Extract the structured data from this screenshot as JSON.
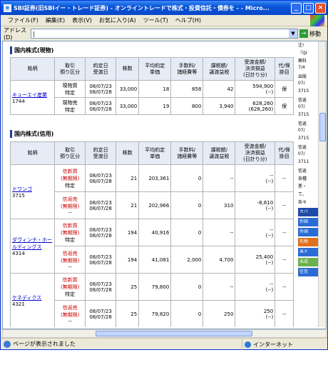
{
  "window": {
    "title": "SBI証券(旧SBIイー・トレード証券) - オンライントレードで株式・投資信託・債券を - - Micro..."
  },
  "menu": [
    "ファイル(F)",
    "編集(E)",
    "表示(V)",
    "お気に入り(A)",
    "ツール(T)",
    "ヘルプ(H)"
  ],
  "address": {
    "label": "アドレス(D)",
    "value": "",
    "go": "移動"
  },
  "spot": {
    "title": "国内株式(現物)",
    "headers": [
      "銘柄",
      "取引\n預り区分",
      "約定日\n受渡日",
      "株数",
      "平均約定\n単価",
      "手数料/\n諸経費等",
      "課税額/\n譲渡益税",
      "受渡金額/\n決済損益\n(日計り分)",
      "代/保\n掛目"
    ],
    "name": "キューエイ産業",
    "code": "1744",
    "rows": [
      {
        "kind": "現物買",
        "acct": "特定",
        "date": "08/07/23",
        "settle": "08/07/28",
        "qty": "33,000",
        "price": "18",
        "fee": "858",
        "tax": "42",
        "amount": "594,900",
        "pl": "(--)",
        "flag": "保"
      },
      {
        "kind": "現物売",
        "acct": "特定",
        "date": "08/07/23",
        "settle": "08/07/28",
        "qty": "33,000",
        "price": "19",
        "fee": "800",
        "tax": "3,940",
        "amount": "628,260",
        "pl": "(628,260)",
        "flag": "保"
      }
    ]
  },
  "margin": {
    "title": "国内株式(信用)",
    "headers": [
      "銘柄",
      "取引\n預り区分",
      "約定日\n受渡日",
      "株数",
      "平均約定\n単価",
      "手数料/\n諸経費等",
      "課税額/\n譲渡益税",
      "受渡金額/\n決済損益\n(日計り分)",
      "代/保\n掛目"
    ],
    "groups": [
      {
        "name": "ドワンゴ",
        "code": "3715",
        "rows": [
          {
            "kind": "信新買",
            "term": "(無期限)",
            "acct": "特定",
            "date": "08/07/23",
            "settle": "08/07/28",
            "qty": "21",
            "price": "203,361",
            "fee": "0",
            "tax": "--",
            "amount": "--",
            "pl": "(--)",
            "flag": "--"
          },
          {
            "kind": "信返売",
            "term": "(無期限)",
            "acct": "--",
            "date": "08/07/23",
            "settle": "08/07/28",
            "qty": "21",
            "price": "202,966",
            "fee": "0",
            "tax": "310",
            "amount": "-8,610",
            "pl": "(--)",
            "flag": "--"
          }
        ]
      },
      {
        "name": "ダヴィンチ・ホールディングス",
        "code": "4314",
        "rows": [
          {
            "kind": "信新買",
            "term": "(無期限)",
            "acct": "特定",
            "date": "08/07/23",
            "settle": "08/07/28",
            "qty": "194",
            "price": "40,916",
            "fee": "0",
            "tax": "--",
            "amount": "--",
            "pl": "(--)",
            "flag": "--"
          },
          {
            "kind": "信返売",
            "term": "(無期限)",
            "acct": "--",
            "date": "08/07/23",
            "settle": "08/07/28",
            "qty": "194",
            "price": "41,081",
            "fee": "2,000",
            "tax": "4,700",
            "amount": "25,400",
            "pl": "(--)",
            "flag": "--"
          }
        ]
      },
      {
        "name": "ケネディクス",
        "code": "4321",
        "rows": [
          {
            "kind": "信新買",
            "term": "(無期限)",
            "acct": "特定",
            "date": "08/07/23",
            "settle": "08/07/28",
            "qty": "25",
            "price": "79,800",
            "fee": "0",
            "tax": "--",
            "amount": "--",
            "pl": "(--)",
            "flag": "--"
          },
          {
            "kind": "信返売",
            "term": "(無期限)",
            "acct": "--",
            "date": "08/07/23",
            "settle": "08/07/28",
            "qty": "25",
            "price": "79,820",
            "fee": "0",
            "tax": "250",
            "amount": "250",
            "pl": "(--)",
            "flag": "--"
          }
        ]
      }
    ]
  },
  "side": {
    "texts": [
      "注!",
      "「QI",
      "無料",
      "7/4",
      "出版",
      "07/",
      "3715",
      "信返",
      "07/",
      "3715",
      "信返",
      "07/",
      "3715",
      "信返",
      "07/",
      "3711",
      "信返",
      "各種",
      "票・",
      "て、",
      "各々"
    ],
    "buttons": [
      {
        "label": "カバ",
        "color": "#1e4aa8"
      },
      {
        "label": "外国",
        "color": "#2b6cd4"
      },
      {
        "label": "外国",
        "color": "#2b6cd4"
      },
      {
        "label": "先物",
        "color": "#e07020"
      },
      {
        "label": "米ド",
        "color": "#2b6cd4"
      },
      {
        "label": "未成",
        "color": "#6ab04c"
      },
      {
        "label": "往信",
        "color": "#2b6cd4"
      }
    ]
  },
  "status": {
    "text": "ページが表示されました",
    "zone": "インターネット"
  }
}
